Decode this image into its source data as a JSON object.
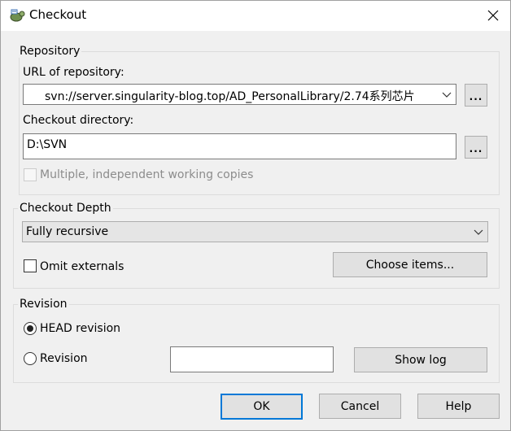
{
  "window": {
    "title": "Checkout",
    "app_icon": "svn-turtle-icon",
    "close_icon": "close-icon"
  },
  "repository": {
    "group_label": "Repository",
    "url_label": "URL of repository:",
    "url_value": "svn://server.singularity-blog.top/AD_PersonalLibrary/2.74系列芯片",
    "url_browse_label": "...",
    "dir_label": "Checkout directory:",
    "dir_value": "D:\\SVN",
    "dir_browse_label": "...",
    "multiple_label": "Multiple, independent working copies",
    "multiple_checked": false,
    "multiple_enabled": false
  },
  "depth": {
    "group_label": "Checkout Depth",
    "selected": "Fully recursive",
    "omit_label": "Omit externals",
    "omit_checked": false,
    "choose_items_label": "Choose items..."
  },
  "revision": {
    "group_label": "Revision",
    "head_label": "HEAD revision",
    "head_selected": true,
    "rev_label": "Revision",
    "rev_value": "",
    "show_log_label": "Show log"
  },
  "buttons": {
    "ok": "OK",
    "cancel": "Cancel",
    "help": "Help"
  },
  "colors": {
    "default_button_border": "#0078d7",
    "dialog_background": "#f0f0f0"
  }
}
